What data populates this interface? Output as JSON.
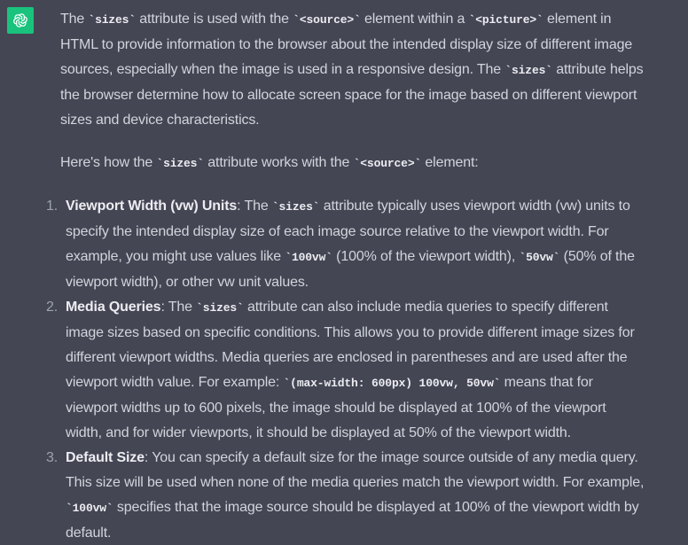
{
  "assistant": {
    "avatar_icon": "openai-logo-icon",
    "avatar_color": "#19c37d"
  },
  "message": {
    "p1": {
      "t1": "The ",
      "c1": "`sizes`",
      "t2": " attribute is used with the ",
      "c2": "`<source>`",
      "t3": " element within a ",
      "c3": "`<picture>`",
      "t4": " element in HTML to provide information to the browser about the intended display size of different image sources, especially when the image is used in a responsive design. The ",
      "c4": "`sizes`",
      "t5": " attribute helps the browser determine how to allocate screen space for the image based on different viewport sizes and device characteristics."
    },
    "p2": {
      "t1": "Here's how the ",
      "c1": "`sizes`",
      "t2": " attribute works with the ",
      "c2": "`<source>`",
      "t3": " element:"
    },
    "items": [
      {
        "number": "1.",
        "title": "Viewport Width (vw) Units",
        "t1": ": The ",
        "c1": "`sizes`",
        "t2": " attribute typically uses viewport width (vw) units to specify the intended display size of each image source relative to the viewport width. For example, you might use values like ",
        "c2": "`100vw`",
        "t3": " (100% of the viewport width), ",
        "c3": "`50vw`",
        "t4": " (50% of the viewport width), or other vw unit values."
      },
      {
        "number": "2.",
        "title": "Media Queries",
        "t1": ": The ",
        "c1": "`sizes`",
        "t2": " attribute can also include media queries to specify different image sizes based on specific conditions. This allows you to provide different image sizes for different viewport widths. Media queries are enclosed in parentheses and are used after the viewport width value. For example: ",
        "c2": "`(max-width: 600px) 100vw, 50vw`",
        "t3": " means that for viewport widths up to 600 pixels, the image should be displayed at 100% of the viewport width, and for wider viewports, it should be displayed at 50% of the viewport width."
      },
      {
        "number": "3.",
        "title": "Default Size",
        "t1": ": You can specify a default size for the image source outside of any media query. This size will be used when none of the media queries match the viewport width. For example, ",
        "c1": "`100vw`",
        "t2": " specifies that the image source should be displayed at 100% of the viewport width by default."
      }
    ]
  }
}
